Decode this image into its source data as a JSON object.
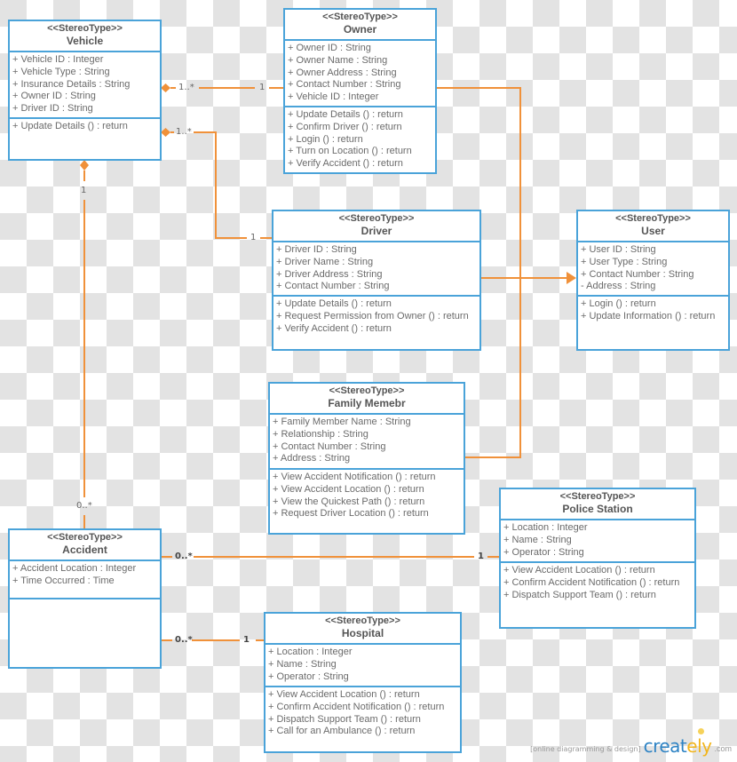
{
  "colors": {
    "box_border": "#4aa3d9",
    "connector": "#f0913a",
    "text": "#6b6b6b"
  },
  "classes": {
    "vehicle": {
      "stereotype": "<<StereoType>>",
      "name": "Vehicle",
      "attributes": [
        "+ Vehicle ID : Integer",
        "+ Vehicle Type : String",
        "+ Insurance Details : String",
        "+ Owner ID : String",
        "+ Driver ID : String"
      ],
      "operations": [
        "+ Update Details () : return"
      ]
    },
    "owner": {
      "stereotype": "<<StereoType>>",
      "name": "Owner",
      "attributes": [
        "+ Owner ID : String",
        "+ Owner Name : String",
        "+ Owner Address : String",
        "+ Contact Number : String",
        "+ Vehicle ID : Integer"
      ],
      "operations": [
        "+ Update Details () : return",
        "+ Confirm Driver () : return",
        "+ Login () : return",
        "+ Turn on Location () : return",
        "+ Verify Accident () : return"
      ]
    },
    "driver": {
      "stereotype": "<<StereoType>>",
      "name": "Driver",
      "attributes": [
        "+ Driver ID : String",
        "+ Driver Name : String",
        "+ Driver Address : String",
        "+ Contact Number : String"
      ],
      "operations": [
        "+ Update Details () : return",
        "+ Request Permission from Owner () : return",
        "+ Verify Accident () : return"
      ]
    },
    "user": {
      "stereotype": "<<StereoType>>",
      "name": "User",
      "attributes": [
        "+ User ID : String",
        "+ User Type : String",
        "+ Contact Number : String",
        "- Address : String"
      ],
      "operations": [
        "+ Login () : return",
        "+ Update Information () : return"
      ]
    },
    "family_member": {
      "stereotype": "<<StereoType>>",
      "name": "Family Memebr",
      "attributes": [
        "+ Family Member Name : String",
        "+ Relationship : String",
        "+ Contact Number : String",
        "+ Address : String"
      ],
      "operations": [
        "+ View Accident Notification () : return",
        "+ View Accident Location () : return",
        "+ View the Quickest Path () : return",
        "+ Request Driver Location () : return"
      ]
    },
    "police_station": {
      "stereotype": "<<StereoType>>",
      "name": "Police Station",
      "attributes": [
        "+ Location : Integer",
        "+ Name : String",
        "+ Operator : String"
      ],
      "operations": [
        "+ View Accident Location () : return",
        "+ Confirm Accident Notification () : return",
        "+ Dispatch Support Team () : return"
      ]
    },
    "accident": {
      "stereotype": "<<StereoType>>",
      "name": "Accident",
      "attributes": [
        "+ Accident Location : Integer",
        "+ Time Occurred : Time"
      ],
      "operations": []
    },
    "hospital": {
      "stereotype": "<<StereoType>>",
      "name": "Hospital",
      "attributes": [
        "+ Location : Integer",
        "+ Name : String",
        "+ Operator : String"
      ],
      "operations": [
        "+ View Accident Location () : return",
        "+ Confirm Accident Notification () : return",
        "+ Dispatch Support Team () : return",
        "+ Call for an Ambulance () : return"
      ]
    }
  },
  "relationships": [
    {
      "from": "Vehicle",
      "to": "Owner",
      "type": "composition",
      "from_multiplicity": "1..*",
      "to_multiplicity": "1"
    },
    {
      "from": "Vehicle",
      "to": "Driver",
      "type": "composition",
      "from_multiplicity": "1..*",
      "to_multiplicity": "1"
    },
    {
      "from": "Vehicle",
      "to": "Accident",
      "type": "composition",
      "from_multiplicity": "1",
      "to_multiplicity": "0..*"
    },
    {
      "from": "Owner",
      "to": "Family Memebr",
      "type": "association",
      "from_multiplicity": "",
      "to_multiplicity": ""
    },
    {
      "from": "Driver",
      "to": "User",
      "type": "generalization",
      "from_multiplicity": "",
      "to_multiplicity": ""
    },
    {
      "from": "Accident",
      "to": "Police Station",
      "type": "association",
      "from_multiplicity": "0..*",
      "to_multiplicity": "1"
    },
    {
      "from": "Accident",
      "to": "Hospital",
      "type": "association",
      "from_multiplicity": "0..*",
      "to_multiplicity": "1"
    }
  ],
  "multiplicity_labels": {
    "vehicle_owner_src": "1..*",
    "vehicle_owner_dst": "1",
    "vehicle_driver_src": "1..*",
    "vehicle_driver_dst": "1",
    "vehicle_accident_src": "1",
    "vehicle_accident_dst": "0..*",
    "accident_police_src": "0..*",
    "accident_police_dst": "1",
    "accident_hospital_src": "0..*",
    "accident_hospital_dst": "1"
  },
  "watermark": {
    "tagline": "[online diagramming & design]",
    "brand_main": "creat",
    "brand_accent": "ely",
    "suffix": ".com"
  }
}
